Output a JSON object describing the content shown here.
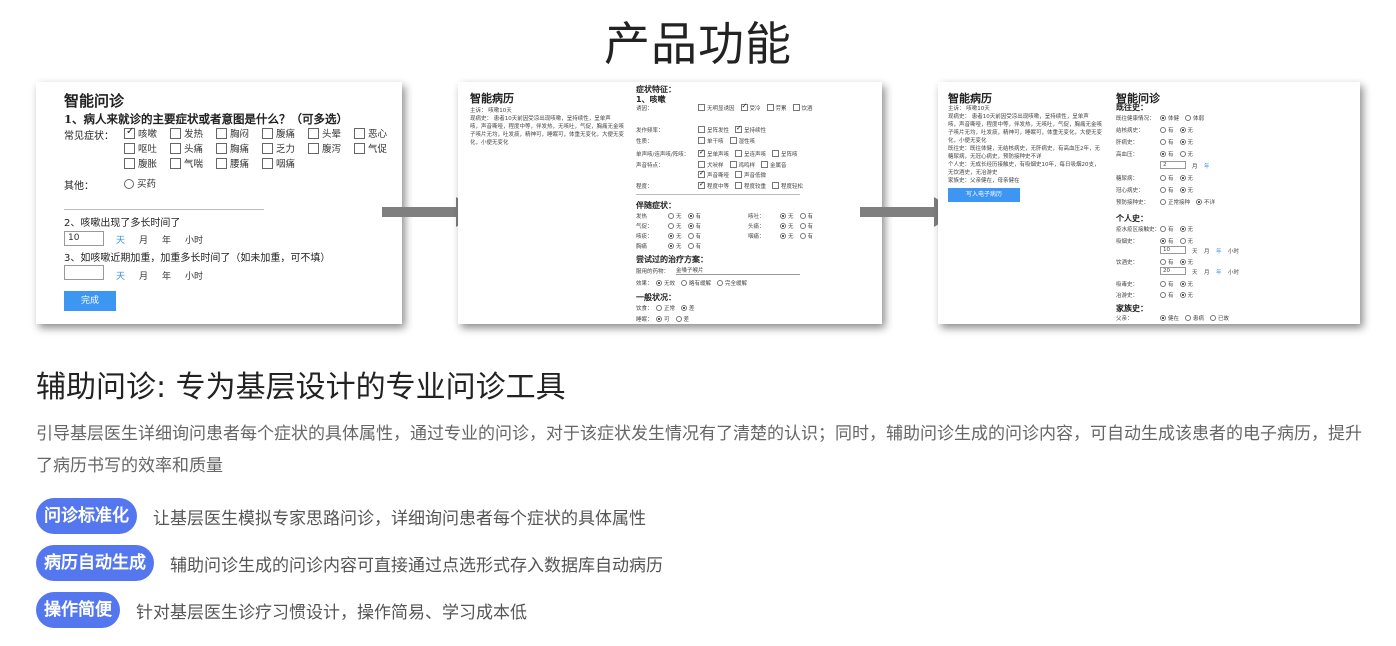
{
  "page_title": "产品功能",
  "shot1": {
    "title": "智能问诊",
    "q1": "1、病人来就诊的主要症状或者意图是什么？（可多选）",
    "common_label": "常见症状：",
    "symptoms": [
      {
        "label": "咳嗽",
        "checked": true
      },
      {
        "label": "发热",
        "checked": false
      },
      {
        "label": "胸闷",
        "checked": false
      },
      {
        "label": "腹痛",
        "checked": false
      },
      {
        "label": "头晕",
        "checked": false
      },
      {
        "label": "恶心",
        "checked": false
      },
      {
        "label": "呕吐",
        "checked": false
      },
      {
        "label": "头痛",
        "checked": false
      },
      {
        "label": "胸痛",
        "checked": false
      },
      {
        "label": "乏力",
        "checked": false
      },
      {
        "label": "腹泻",
        "checked": false
      },
      {
        "label": "气促",
        "checked": false
      },
      {
        "label": "腹胀",
        "checked": false
      },
      {
        "label": "气喘",
        "checked": false
      },
      {
        "label": "腰痛",
        "checked": false
      },
      {
        "label": "咽痛",
        "checked": false
      }
    ],
    "other_label": "其他：",
    "other_option": "买药",
    "q2": "2、咳嗽出现了多长时间了",
    "q2_value": "10",
    "units": [
      "天",
      "月",
      "年",
      "小时"
    ],
    "q3": "3、如咳嗽近期加重，加重多长时间了（如未加重，可不填）",
    "q3_value": "",
    "done_button": "完成"
  },
  "shot2": {
    "title": "智能病历",
    "lines": [
      "主诉：   咳嗽10天",
      "现病史：   患者10天前因受凉出现咳嗽，呈持续性，呈单声",
      "咳，声音嘶哑，程度中等，伴发热，无咳吐，气促，胸痛无金咳",
      "子咳片无均，吐发痰，精神可，睡眠可，体重无变化，大便无变",
      "化，小便无变化"
    ],
    "h_features": "症状特征：",
    "h_cough": "1、咳嗽",
    "rows": [
      {
        "label": "诱因：",
        "opts": [
          {
            "t": "无明显诱因",
            "c": false
          },
          {
            "t": "受冷",
            "c": true
          },
          {
            "t": "劳累",
            "c": false
          },
          {
            "t": "饮酒",
            "c": false
          }
        ]
      },
      {
        "label": "发作频率：",
        "opts": [
          {
            "t": "呈阵发性",
            "c": false
          },
          {
            "t": "呈持续性",
            "c": true
          }
        ]
      },
      {
        "label": "性质：",
        "opts": [
          {
            "t": "单干咳",
            "c": false
          },
          {
            "t": "湿性咳",
            "c": false
          }
        ]
      },
      {
        "label": "单声咳/连声咳/阵咳：",
        "opts": [
          {
            "t": "呈单声咳",
            "c": true
          },
          {
            "t": "呈连声咳",
            "c": false
          },
          {
            "t": "呈阵咳",
            "c": false
          }
        ]
      },
      {
        "label": "声音特点：",
        "opts": [
          {
            "t": "犬吠样",
            "c": false
          },
          {
            "t": "鸡鸣样",
            "c": false
          },
          {
            "t": "金属音",
            "c": false
          }
        ]
      },
      {
        "label": "",
        "opts": [
          {
            "t": "声音嘶哑",
            "c": true
          },
          {
            "t": "声音低微",
            "c": false
          }
        ]
      },
      {
        "label": "程度：",
        "opts": [
          {
            "t": "程度中等",
            "c": true
          },
          {
            "t": "程度较重",
            "c": false
          },
          {
            "t": "程度轻松",
            "c": false
          }
        ]
      }
    ],
    "h_accompany": "伴随症状：",
    "accompany": [
      {
        "l": "发热",
        "on": "有",
        "r": "咳吐：",
        "ron": "无"
      },
      {
        "l": "气促：",
        "on": "有",
        "r": "头痛：",
        "ron": "无"
      },
      {
        "l": "咳痰：",
        "on": "无",
        "r": "咽痛：",
        "ron": "无"
      },
      {
        "l": "胸痛",
        "on": "无",
        "r": "",
        "ron": ""
      }
    ],
    "yes": "有",
    "no": "无",
    "h_treatment": "尝试过的治疗方案：",
    "drug_label": "服用的药物：",
    "drug_value": "金嗓子喉片",
    "effect_label": "效果：",
    "effects": [
      {
        "t": "无效",
        "c": true
      },
      {
        "t": "略有缓解",
        "c": false
      },
      {
        "t": "完全缓解",
        "c": false
      }
    ],
    "h_general": "一般状况：",
    "diet_label": "饮食：",
    "diet": [
      {
        "t": "正常",
        "c": false
      },
      {
        "t": "差",
        "c": true
      }
    ],
    "sleep_label": "睡眠：",
    "sleep": [
      {
        "t": "可",
        "c": true
      },
      {
        "t": "差",
        "c": false
      }
    ]
  },
  "shot3": {
    "title_left": "智能病历",
    "lines": [
      "主诉：   咳嗽10天",
      "现病史：   患者10天前因受凉出现咳嗽，呈持续性，呈单声",
      "咳，声音嘶哑，程度中等，伴发热，无咳吐，气促，胸痛无金咳",
      "子咳片无均，吐发痰，精神可，睡眠可，体重无变化，大便无变",
      "化，小便无变化",
      "既往史：既往体健，无结核病史，无肝病史，有高血压2年，无",
      "糖尿病，无冠心病史，预防接种史不详",
      "个人史：无成长经历接触史，有吸烟史10年，每日吸烟20支，",
      "无饮酒史，无冶游史",
      "家族史：父亲健在，母亲健在"
    ],
    "write_button": "写入电子病历",
    "title_right": "智能问诊",
    "h_past": "既往史：",
    "past": [
      {
        "label": "既往健康情况：",
        "opts": [
          {
            "t": "体健",
            "c": true
          },
          {
            "t": "体弱",
            "c": false
          }
        ]
      },
      {
        "label": "结核病史：",
        "opts": [
          {
            "t": "有",
            "c": false
          },
          {
            "t": "无",
            "c": true
          }
        ]
      },
      {
        "label": "肝病史：",
        "opts": [
          {
            "t": "有",
            "c": false
          },
          {
            "t": "无",
            "c": true
          }
        ]
      },
      {
        "label": "高血压：",
        "opts": [
          {
            "t": "有",
            "c": true
          },
          {
            "t": "无",
            "c": false
          }
        ]
      }
    ],
    "bp_value": "2",
    "bp_units": [
      "月",
      "年"
    ],
    "past2": [
      {
        "label": "糖尿病：",
        "opts": [
          {
            "t": "有",
            "c": false
          },
          {
            "t": "无",
            "c": true
          }
        ]
      },
      {
        "label": "冠心病史：",
        "opts": [
          {
            "t": "有",
            "c": false
          },
          {
            "t": "无",
            "c": true
          }
        ]
      },
      {
        "label": "预防接种史：",
        "opts": [
          {
            "t": "正常接种",
            "c": false
          },
          {
            "t": "不详",
            "c": true
          }
        ]
      }
    ],
    "h_personal": "个人史：",
    "personal1": {
      "label": "疫水疫区接触史：",
      "opts": [
        {
          "t": "有",
          "c": false
        },
        {
          "t": "无",
          "c": true
        }
      ]
    },
    "personal2": {
      "label": "吸烟史：",
      "opts": [
        {
          "t": "有",
          "c": true
        },
        {
          "t": "无",
          "c": false
        }
      ]
    },
    "smoke_value": "10",
    "smoke_units": [
      "天",
      "月",
      "年",
      "小时"
    ],
    "personal3": {
      "label": "饮酒史：",
      "opts": [
        {
          "t": "有",
          "c": false
        },
        {
          "t": "无",
          "c": true
        }
      ]
    },
    "drink_value": "20",
    "drink_units": [
      "天",
      "月",
      "年",
      "小时"
    ],
    "personal4": {
      "label": "吸毒史：",
      "opts": [
        {
          "t": "有",
          "c": false
        },
        {
          "t": "无",
          "c": true
        }
      ]
    },
    "personal5": {
      "label": "冶游史：",
      "opts": [
        {
          "t": "有",
          "c": false
        },
        {
          "t": "无",
          "c": true
        }
      ]
    },
    "h_family": "家族史：",
    "family": {
      "label": "父亲：",
      "opts": [
        {
          "t": "健在",
          "c": true
        },
        {
          "t": "患病",
          "c": false
        },
        {
          "t": "已故",
          "c": false
        }
      ]
    }
  },
  "section": {
    "title": "辅助问诊: 专为基层设计的专业问诊工具",
    "description": "引导基层医生详细询问患者每个症状的具体属性，通过专业的问诊，对于该症状发生情况有了清楚的认识；同时，辅助问诊生成的问诊内容，可自动生成该患者的电子病历，提升了病历书写的效率和质量"
  },
  "features": [
    {
      "tag": "问诊标准化",
      "text": "让基层医生模拟专家思路问诊，详细询问患者每个症状的具体属性"
    },
    {
      "tag": "病历自动生成",
      "text": "辅助问诊生成的问诊内容可直接通过点选形式存入数据库自动病历"
    },
    {
      "tag": "操作简便",
      "text": "针对基层医生诊疗习惯设计，操作简易、学习成本低"
    }
  ],
  "colors": {
    "pill": "#5477f0",
    "accent_blue": "#3e96f3",
    "arrow": "#7f7f7f"
  }
}
